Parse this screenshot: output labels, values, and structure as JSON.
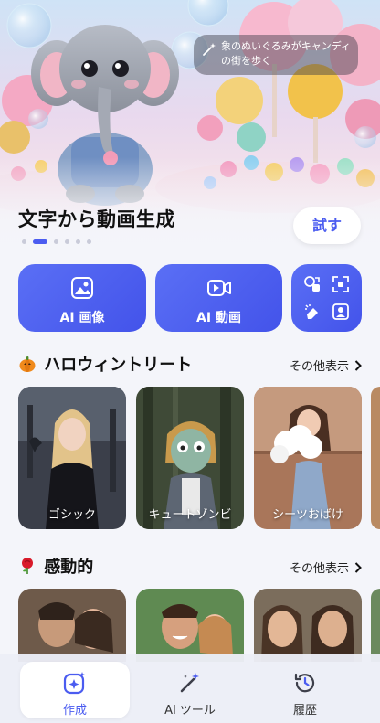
{
  "hero": {
    "prompt": "象のぬいぐるみがキャンディの街を歩く",
    "title": "文字から動画生成",
    "try_label": "試す",
    "slides_total": 6,
    "slide_active": 2
  },
  "tools": [
    {
      "label": "AI 画像",
      "icon": "image-icon"
    },
    {
      "label": "AI 動画",
      "icon": "video-icon"
    }
  ],
  "tool_grid_icons": [
    "swap-icon",
    "crop-expand-icon",
    "eraser-icon",
    "portrait-icon"
  ],
  "sections": [
    {
      "emoji": "pumpkin",
      "title": "ハロウィントリート",
      "more": "その他表示",
      "cards": [
        {
          "label": "ゴシック"
        },
        {
          "label": "キュートゾンビ"
        },
        {
          "label": "シーツおばけ"
        }
      ]
    },
    {
      "emoji": "rose",
      "title": "感動的",
      "more": "その他表示"
    }
  ],
  "tabbar": [
    {
      "label": "作成",
      "icon": "sparkle-create-icon",
      "active": true
    },
    {
      "label": "AI ツール",
      "icon": "magic-wand-icon",
      "active": false
    },
    {
      "label": "履歴",
      "icon": "history-icon",
      "active": false
    }
  ],
  "colors": {
    "accent": "#4b5cf0",
    "tool_gradient_start": "#5a6ff5",
    "tool_gradient_end": "#4353ea",
    "background": "#f4f5fa"
  }
}
